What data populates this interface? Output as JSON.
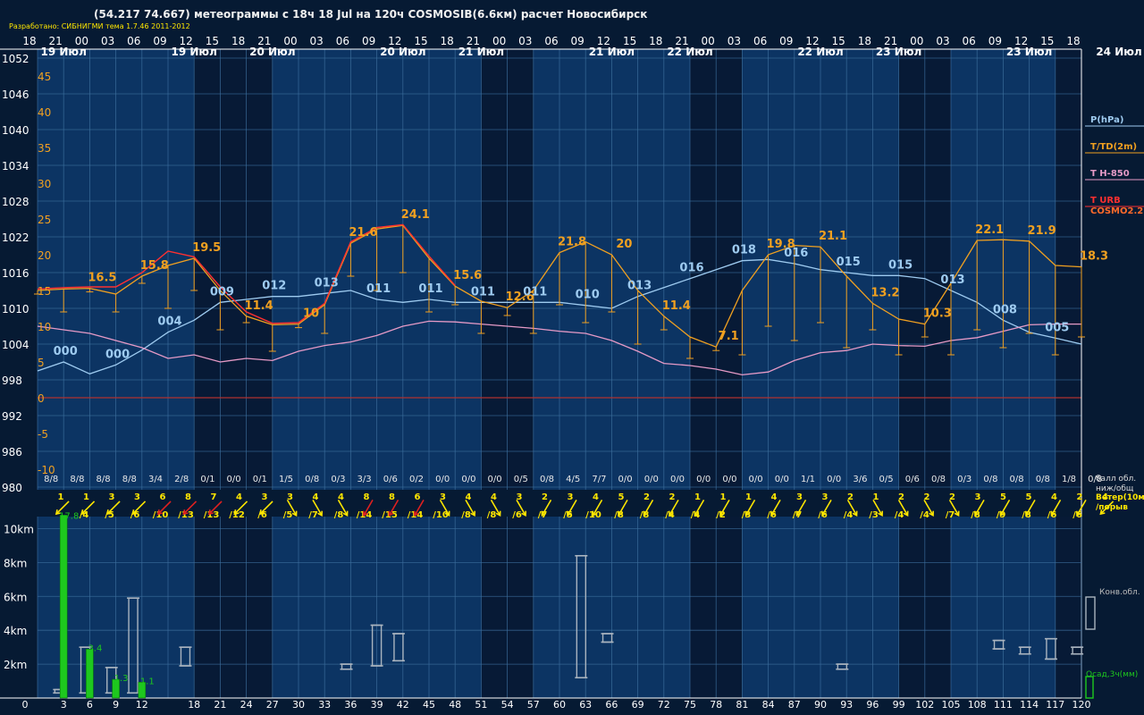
{
  "header": {
    "title": "(54.217 74.667) метеограммы с  18ч 18 Jul на 120ч COSMOSIB(6.6км) расчет Новосибирск",
    "subtitle": "Разработано: СИБНИГМИ тема 1.7.46 2011-2012"
  },
  "colors": {
    "background": "#061a33",
    "band_light": "#0f3d73",
    "band_dark": "#071a36",
    "grid": "#3d6f9e",
    "pressure": "#9ecbf0",
    "temperature": "#f0a020",
    "t850": "#e69ac6",
    "t_urb": "#ff3030",
    "cosmo": "#ff6a2a",
    "zero_line": "#b03030",
    "wind_yellow": "#ffe600",
    "wind_red": "#e02020",
    "precip": "#1ec81e",
    "cloud": "#aab4bf"
  },
  "chart_data": {
    "type": "line",
    "x_hour_labels": [
      "18",
      "21",
      "00",
      "03",
      "06",
      "09",
      "12",
      "15",
      "18",
      "21",
      "00",
      "03",
      "06",
      "09",
      "12",
      "15",
      "18",
      "21",
      "00",
      "03",
      "06",
      "09",
      "12",
      "15",
      "18",
      "21",
      "00",
      "03",
      "06",
      "09",
      "12",
      "15",
      "18",
      "21",
      "00",
      "03",
      "06",
      "09",
      "12",
      "15",
      "18"
    ],
    "date_labels": [
      {
        "hour": 3,
        "text": "19 Июл"
      },
      {
        "hour": 18,
        "text": "19 Июл"
      },
      {
        "hour": 27,
        "text": "20 Июл"
      },
      {
        "hour": 42,
        "text": "20 Июл"
      },
      {
        "hour": 51,
        "text": "21 Июл"
      },
      {
        "hour": 66,
        "text": "21 Июл"
      },
      {
        "hour": 75,
        "text": "22 Июл"
      },
      {
        "hour": 90,
        "text": "22 Июл"
      },
      {
        "hour": 99,
        "text": "23 Июл"
      },
      {
        "hour": 114,
        "text": "23 Июл"
      },
      {
        "hour": 123,
        "text": "24 Июл"
      }
    ],
    "pressure_axis": {
      "ticks": [
        1052,
        1046,
        1040,
        1034,
        1028,
        1022,
        1016,
        1010,
        1004,
        998,
        992,
        986,
        980
      ],
      "range": [
        980,
        1052
      ]
    },
    "temperature_axis": {
      "ticks": [
        45,
        40,
        35,
        30,
        25,
        20,
        15,
        10,
        5,
        0,
        -5,
        -10
      ],
      "range": [
        -10,
        45
      ]
    },
    "legend": [
      {
        "text": "P(hPa)",
        "color": "#9ecbf0"
      },
      {
        "text": "T/TD(2m)",
        "color": "#f0a020"
      },
      {
        "text": "T H-850",
        "color": "#e69ac6"
      },
      {
        "text": "T URB",
        "color": "#ff3030"
      },
      {
        "text": "COSMO2.2",
        "color": "#ff6a2a"
      }
    ],
    "series": [
      {
        "name": "P(hPa)",
        "x": [
          0,
          3,
          6,
          9,
          12,
          15,
          18,
          21,
          24,
          27,
          30,
          33,
          36,
          39,
          42,
          45,
          48,
          51,
          54,
          57,
          60,
          63,
          66,
          69,
          72,
          75,
          78,
          81,
          84,
          87,
          90,
          93,
          96,
          99,
          102,
          105,
          108,
          111,
          114,
          117,
          120
        ],
        "y": [
          999.5,
          1001,
          999,
          1000.5,
          1003,
          1006,
          1008,
          1011,
          1011.5,
          1012,
          1012,
          1012.5,
          1013,
          1011.5,
          1011,
          1011.5,
          1011,
          1011,
          1011,
          1011,
          1011,
          1010.5,
          1010,
          1012,
          1013.5,
          1015,
          1016.5,
          1018,
          1018.2,
          1017.5,
          1016.5,
          1016,
          1015.5,
          1015.5,
          1015,
          1013,
          1011,
          1008,
          1006,
          1005,
          1004
        ]
      },
      {
        "name": "T/TD(2m)",
        "x": [
          0,
          3,
          6,
          9,
          12,
          15,
          18,
          21,
          24,
          27,
          30,
          33,
          36,
          39,
          42,
          45,
          48,
          51,
          54,
          57,
          60,
          63,
          66,
          69,
          72,
          75,
          78,
          81,
          84,
          87,
          90,
          93,
          96,
          99,
          102,
          105,
          108,
          111,
          114,
          117,
          120
        ],
        "y": [
          15,
          15.2,
          15.3,
          14.5,
          17,
          18.5,
          19.5,
          15,
          11.4,
          10.2,
          10.3,
          13,
          21.6,
          23.6,
          24.1,
          19.5,
          15.6,
          13.5,
          12.6,
          15,
          20.3,
          21.8,
          20,
          15,
          11.4,
          8.5,
          7.1,
          15,
          20,
          21.3,
          21.1,
          17,
          13.2,
          11,
          10.3,
          16,
          22,
          22.1,
          21.9,
          18.5,
          18.3
        ]
      },
      {
        "name": "T/TD(2m) dew point",
        "x": [
          0,
          3,
          6,
          9,
          12,
          15,
          18,
          21,
          24,
          27,
          30,
          33,
          36,
          39,
          42,
          45,
          48,
          51,
          54,
          57,
          60,
          63,
          66,
          69,
          72,
          75,
          78,
          81,
          84,
          87,
          90,
          93,
          96,
          99,
          102,
          105,
          108,
          111,
          114,
          117,
          120
        ],
        "y": [
          15,
          15,
          15,
          15,
          16,
          15.5,
          15,
          12.5,
          10.5,
          9.5,
          10,
          12,
          17,
          18,
          17.5,
          15,
          13,
          12,
          11.5,
          12,
          13,
          13.5,
          12,
          10.5,
          9.5,
          8.5,
          8,
          9,
          10,
          11,
          10.5,
          10,
          9.5,
          9,
          8.5,
          9,
          9.5,
          10,
          9,
          9,
          8.5
        ]
      },
      {
        "name": "T H-850",
        "x": [
          0,
          3,
          6,
          9,
          12,
          15,
          18,
          21,
          24,
          27,
          30,
          33,
          36,
          39,
          42,
          45,
          48,
          51,
          54,
          57,
          60,
          63,
          66,
          69,
          72,
          75,
          78,
          81,
          84,
          87,
          90,
          93,
          96,
          99,
          102,
          105,
          108,
          111,
          114,
          117,
          120
        ],
        "y": [
          10,
          9.5,
          9,
          8,
          7,
          5.5,
          6,
          5,
          5.5,
          5.2,
          6.5,
          7.3,
          7.8,
          8.7,
          10,
          10.7,
          10.6,
          10.3,
          10,
          9.7,
          9.3,
          9,
          8,
          6.5,
          4.8,
          4.5,
          4,
          3.2,
          3.6,
          5.2,
          6.3,
          6.6,
          7.5,
          7.3,
          7.2,
          8,
          8.4,
          9.3,
          10.2,
          10.3,
          10.3
        ]
      },
      {
        "name": "T URB",
        "x": [
          0,
          3,
          6,
          9,
          12,
          15,
          18,
          21,
          24,
          27,
          30,
          33,
          36,
          39,
          42,
          45,
          48
        ],
        "y": [
          15.2,
          15.4,
          15.5,
          15.5,
          17.5,
          20.5,
          19.7,
          15.5,
          12,
          10.4,
          10.5,
          13.2,
          21.8,
          23.8,
          24.2,
          19.8,
          15.7
        ]
      }
    ],
    "point_labels_T": [
      {
        "x": 6,
        "text": "16.5"
      },
      {
        "x": 12,
        "text": "15.8"
      },
      {
        "x": 18,
        "text": "19.5"
      },
      {
        "x": 24,
        "text": "11.4"
      },
      {
        "x": 30,
        "text": "10"
      },
      {
        "x": 36,
        "text": "21.6"
      },
      {
        "x": 42,
        "text": "24.1"
      },
      {
        "x": 48,
        "text": "15.6"
      },
      {
        "x": 54,
        "text": "12.6"
      },
      {
        "x": 60,
        "text": "21.8"
      },
      {
        "x": 66,
        "text": "20"
      },
      {
        "x": 72,
        "text": "11.4"
      },
      {
        "x": 78,
        "text": "7.1"
      },
      {
        "x": 84,
        "text": "19.8"
      },
      {
        "x": 90,
        "text": "21.1"
      },
      {
        "x": 96,
        "text": "13.2"
      },
      {
        "x": 102,
        "text": "10.3"
      },
      {
        "x": 108,
        "text": "22.1"
      },
      {
        "x": 114,
        "text": "21.9"
      },
      {
        "x": 120,
        "text": "18.3"
      }
    ],
    "point_labels_P": [
      {
        "x": 3,
        "text": "000"
      },
      {
        "x": 9,
        "text": "000"
      },
      {
        "x": 15,
        "text": "004"
      },
      {
        "x": 21,
        "text": "009"
      },
      {
        "x": 27,
        "text": "012"
      },
      {
        "x": 33,
        "text": "013"
      },
      {
        "x": 39,
        "text": "011"
      },
      {
        "x": 45,
        "text": "011"
      },
      {
        "x": 51,
        "text": "011"
      },
      {
        "x": 57,
        "text": "011"
      },
      {
        "x": 63,
        "text": "010"
      },
      {
        "x": 69,
        "text": "013"
      },
      {
        "x": 75,
        "text": "016"
      },
      {
        "x": 81,
        "text": "018"
      },
      {
        "x": 87,
        "text": "016"
      },
      {
        "x": 93,
        "text": "015"
      },
      {
        "x": 99,
        "text": "015"
      },
      {
        "x": 105,
        "text": "013"
      },
      {
        "x": 111,
        "text": "008"
      },
      {
        "x": 117,
        "text": "005"
      }
    ],
    "cloud_cover": {
      "label_line1": "балл обл.",
      "label_line2": "ниж/общ",
      "values": [
        "8/8",
        "8/8",
        "8/8",
        "8/8",
        "3/4",
        "2/8",
        "0/1",
        "0/0",
        "0/1",
        "1/5",
        "0/8",
        "0/3",
        "3/3",
        "0/6",
        "0/2",
        "0/0",
        "0/0",
        "0/0",
        "0/5",
        "0/8",
        "4/5",
        "7/7",
        "0/0",
        "0/0",
        "0/0",
        "0/0",
        "0/0",
        "0/0",
        "0/0",
        "1/1",
        "0/0",
        "3/6",
        "0/5",
        "0/6",
        "0/8",
        "0/3",
        "0/8",
        "0/8",
        "0/8",
        "1/8",
        "0/8"
      ]
    },
    "wind": {
      "label_line1": "Ветер(10м",
      "label_line2": "/порыв",
      "speed": [
        "1",
        "1",
        "3",
        "3",
        "6",
        "8",
        "7",
        "4",
        "3",
        "3",
        "4",
        "4",
        "8",
        "8",
        "6",
        "3",
        "4",
        "4",
        "3",
        "2",
        "3",
        "4",
        "5",
        "2",
        "2",
        "1",
        "1",
        "1",
        "4",
        "3",
        "3",
        "2",
        "1",
        "2",
        "2",
        "2",
        "3",
        "5",
        "5",
        "4",
        "2",
        "4"
      ],
      "gust": [
        "/4",
        "/5",
        "/6",
        "/10",
        "/13",
        "/13",
        "/12",
        "/6",
        "/5",
        "/7",
        "/8",
        "/14",
        "/15",
        "/14",
        "/10",
        "/8",
        "/8",
        "/6",
        "/7",
        "/5",
        "/10",
        "/8",
        "/8",
        "/4",
        "/4",
        "/2",
        "/3",
        "/6",
        "/7",
        "/6",
        "/4",
        "/3",
        "/4",
        "/4",
        "/7",
        "/8",
        "/9",
        "/8",
        "/6",
        "/6"
      ],
      "direction_deg": [
        135,
        135,
        135,
        135,
        135,
        135,
        135,
        135,
        135,
        60,
        60,
        60,
        120,
        120,
        120,
        60,
        60,
        60,
        60,
        120,
        120,
        120,
        120,
        120,
        120,
        120,
        120,
        120,
        120,
        120,
        120,
        60,
        60,
        60,
        60,
        60,
        120,
        120,
        120,
        120,
        120
      ],
      "red": [
        false,
        false,
        false,
        false,
        true,
        true,
        true,
        false,
        false,
        false,
        false,
        false,
        true,
        true,
        true,
        false,
        false,
        false,
        false,
        false,
        false,
        false,
        false,
        false,
        false,
        false,
        false,
        false,
        false,
        false,
        false,
        false,
        false,
        false,
        false,
        false,
        false,
        false,
        false,
        false,
        false
      ]
    },
    "height_axis": {
      "ticks": [
        "10km",
        "8km",
        "6km",
        "4km",
        "2km"
      ],
      "values_km": [
        10,
        8,
        6,
        4,
        2
      ],
      "range_km": [
        0,
        11.3
      ]
    },
    "precip_label": "Осад,3ч(мм)",
    "conv_cloud_label": "Конв.обл.",
    "precip_bars": [
      {
        "hour": 3,
        "value": 17.8,
        "label": "17.8"
      },
      {
        "hour": 6,
        "value": 3.4,
        "label": "3.4"
      },
      {
        "hour": 9,
        "value": 1.3,
        "label": "1.3"
      },
      {
        "hour": 12,
        "value": 1.1,
        "label": "1.1"
      }
    ],
    "convective_clouds_km": [
      {
        "hour": 2.5,
        "base": 0.3,
        "top": 0.5
      },
      {
        "hour": 5.5,
        "base": 0.3,
        "top": 3.0
      },
      {
        "hour": 8.5,
        "base": 0.3,
        "top": 1.8
      },
      {
        "hour": 11,
        "base": 0.3,
        "top": 5.9
      },
      {
        "hour": 17,
        "base": 1.9,
        "top": 3.0
      },
      {
        "hour": 35.5,
        "base": 1.7,
        "top": 2.0
      },
      {
        "hour": 39,
        "base": 1.9,
        "top": 4.3
      },
      {
        "hour": 41.5,
        "base": 2.2,
        "top": 3.8
      },
      {
        "hour": 62.5,
        "base": 1.2,
        "top": 8.4
      },
      {
        "hour": 65.5,
        "base": 3.3,
        "top": 3.8
      },
      {
        "hour": 92.5,
        "base": 1.7,
        "top": 2.0
      },
      {
        "hour": 110.5,
        "base": 2.9,
        "top": 3.4
      },
      {
        "hour": 113.5,
        "base": 2.6,
        "top": 3.0
      },
      {
        "hour": 116.5,
        "base": 2.3,
        "top": 3.5
      },
      {
        "hour": 119.5,
        "base": 2.6,
        "top": 3.0
      }
    ],
    "x_bottom_ticks": [
      0,
      3,
      6,
      9,
      12,
      18,
      21,
      24,
      27,
      30,
      33,
      36,
      39,
      42,
      45,
      48,
      51,
      54,
      57,
      60,
      63,
      66,
      69,
      72,
      75,
      78,
      81,
      84,
      87,
      90,
      93,
      96,
      99,
      102,
      105,
      108,
      111,
      114,
      117,
      120
    ]
  }
}
